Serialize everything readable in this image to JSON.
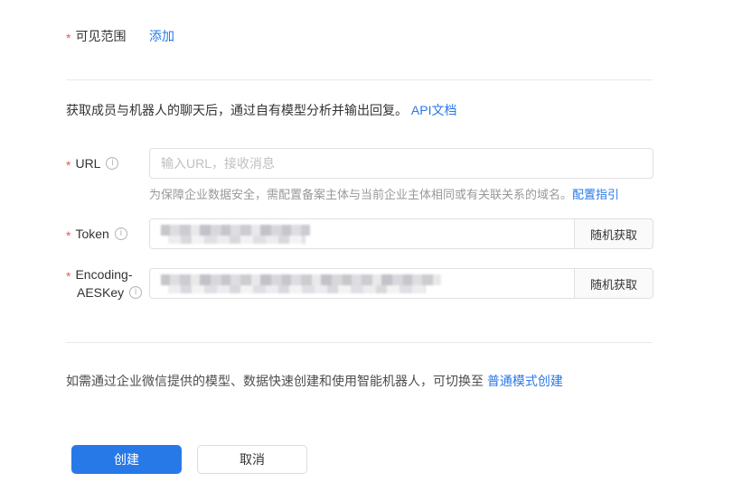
{
  "marks": {
    "required": "*"
  },
  "visible_range": {
    "label": "可见范围",
    "add_link": "添加"
  },
  "intro": {
    "text": "获取成员与机器人的聊天后，通过自有模型分析并输出回复。",
    "link": "API文档"
  },
  "url": {
    "label": "URL",
    "placeholder": "输入URL，接收消息",
    "help_text": "为保障企业数据安全，需配置备案主体与当前企业主体相同或有关联关系的域名。",
    "help_link": "配置指引"
  },
  "token": {
    "label": "Token",
    "random_button": "随机获取"
  },
  "aeskey": {
    "label_line1": "Encoding-",
    "label_line2": "AESKey",
    "random_button": "随机获取"
  },
  "switch_note": {
    "text": "如需通过企业微信提供的模型、数据快速创建和使用智能机器人，可切换至 ",
    "link": "普通模式创建"
  },
  "actions": {
    "create": "创建",
    "cancel": "取消"
  },
  "colors": {
    "primary_blue": "#2879e8",
    "link_blue": "#2879e8",
    "required_red": "#e05c5c",
    "input_border": "#e0e0e0",
    "divider": "#e9e9e9",
    "helper_gray": "#999999",
    "placeholder_gray": "#bfbfbf"
  }
}
